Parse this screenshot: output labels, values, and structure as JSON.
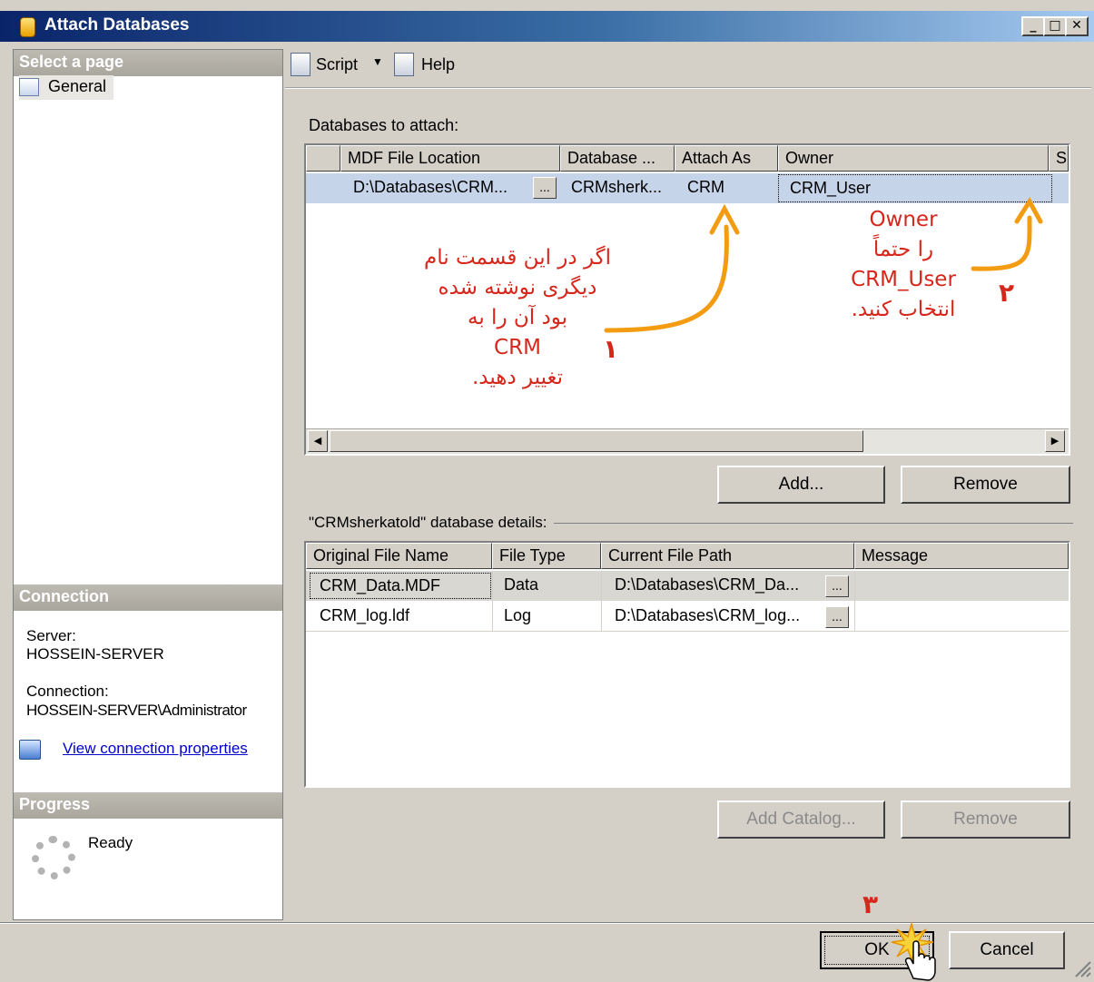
{
  "window": {
    "title": "Attach Databases",
    "controls": {
      "minimize": "_",
      "maximize": "□",
      "close": "✕"
    }
  },
  "left_pane": {
    "select_page_header": "Select a page",
    "pages": [
      {
        "label": "General",
        "icon": "settings-page-icon"
      }
    ],
    "connection_header": "Connection",
    "server_label": "Server:",
    "server_value": "HOSSEIN-SERVER",
    "connection_label": "Connection:",
    "connection_value": "HOSSEIN-SERVER\\Administrator",
    "view_connection_properties": "View connection properties",
    "progress_header": "Progress",
    "progress_status": "Ready"
  },
  "toolbar": {
    "script_label": "Script",
    "help_label": "Help"
  },
  "databases_to_attach": {
    "label": "Databases to attach:",
    "columns": [
      "MDF File Location",
      "Database ...",
      "Attach As",
      "Owner",
      "S"
    ],
    "rows": [
      {
        "mdf_location": "D:\\Databases\\CRM...",
        "ellipsis": "...",
        "database": "CRMsherk...",
        "attach_as": "CRM",
        "owner": "CRM_User"
      }
    ],
    "add_button": "Add...",
    "remove_button": "Remove"
  },
  "database_details": {
    "label": "\"CRMsherkatold\" database details:",
    "columns": [
      "Original File Name",
      "File Type",
      "Current File Path",
      "Message"
    ],
    "rows": [
      {
        "file_name": "CRM_Data.MDF",
        "file_type": "Data",
        "path": "D:\\Databases\\CRM_Da...",
        "ellipsis": "...",
        "message": ""
      },
      {
        "file_name": "CRM_log.ldf",
        "file_type": "Log",
        "path": "D:\\Databases\\CRM_log...",
        "ellipsis": "...",
        "message": ""
      }
    ],
    "add_catalog_button": "Add Catalog...",
    "remove_button": "Remove"
  },
  "footer": {
    "ok_button": "OK",
    "cancel_button": "Cancel"
  },
  "annotations": {
    "note1_lines": [
      "اگر در این قسمت نام",
      "دیگری نوشته شده",
      "بود آن را به",
      "CRM",
      "تغییر دهید."
    ],
    "note1_number": "۱",
    "note2_lines": [
      "Owner",
      "را حتماً",
      "CRM_User",
      "انتخاب کنید."
    ],
    "note2_number": "۲",
    "note3_number": "۳",
    "arrow_color": "#f39c12",
    "text_color": "#d7261b"
  }
}
